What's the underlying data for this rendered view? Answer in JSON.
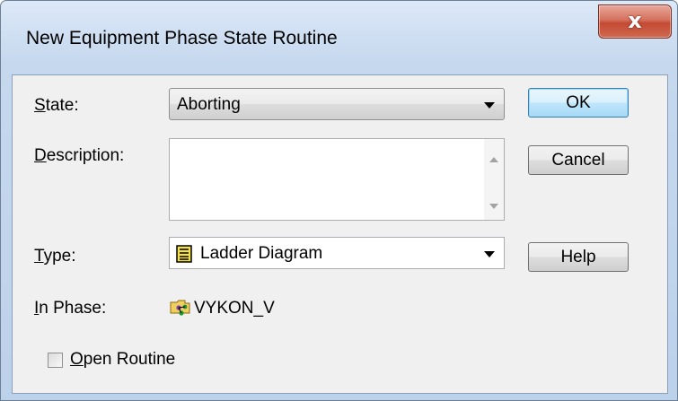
{
  "window": {
    "title": "New Equipment Phase State Routine",
    "close_glyph": "x"
  },
  "form": {
    "state": {
      "label_mnemonic": "S",
      "label_rest": "tate:",
      "value": "Aborting"
    },
    "description": {
      "label_mnemonic": "D",
      "label_rest": "escription:",
      "value": ""
    },
    "type": {
      "label_mnemonic": "T",
      "label_rest": "ype:",
      "value": "Ladder Diagram",
      "icon": "ladder-diagram-icon"
    },
    "in_phase": {
      "label_mnemonic": "I",
      "label_rest": "n Phase:",
      "value": "VYKON_V",
      "icon": "phase-folder-icon"
    },
    "open_routine": {
      "label_mnemonic": "O",
      "label_rest": "pen Routine",
      "checked": false
    }
  },
  "buttons": {
    "ok": "OK",
    "cancel": "Cancel",
    "help": "Help"
  }
}
